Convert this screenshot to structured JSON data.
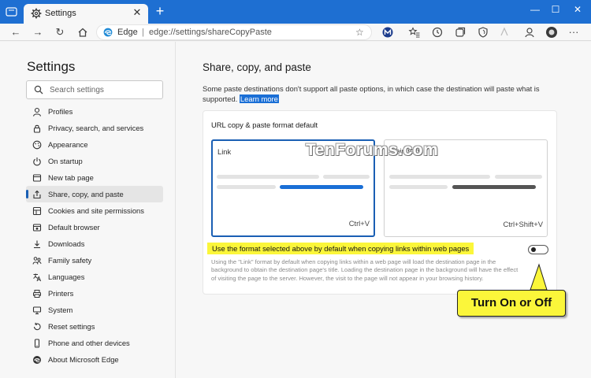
{
  "browser": {
    "tab_title": "Settings",
    "tab_close": "✕",
    "new_tab": "+",
    "window_controls": {
      "minimize": "—",
      "maximize": "☐",
      "close": "✕"
    },
    "address": {
      "brand": "Edge",
      "separator": "|",
      "url": "edge://settings/shareCopyPaste"
    },
    "accent": "#1e6fd2"
  },
  "sidebar": {
    "title": "Settings",
    "search_placeholder": "Search settings",
    "items": [
      {
        "label": "Profiles",
        "icon": "profile-icon"
      },
      {
        "label": "Privacy, search, and services",
        "icon": "lock-icon"
      },
      {
        "label": "Appearance",
        "icon": "appearance-icon"
      },
      {
        "label": "On startup",
        "icon": "power-icon"
      },
      {
        "label": "New tab page",
        "icon": "new-tab-page-icon"
      },
      {
        "label": "Share, copy, and paste",
        "icon": "share-icon",
        "active": true
      },
      {
        "label": "Cookies and site permissions",
        "icon": "permissions-icon"
      },
      {
        "label": "Default browser",
        "icon": "default-browser-icon"
      },
      {
        "label": "Downloads",
        "icon": "download-icon"
      },
      {
        "label": "Family safety",
        "icon": "family-icon"
      },
      {
        "label": "Languages",
        "icon": "languages-icon"
      },
      {
        "label": "Printers",
        "icon": "printer-icon"
      },
      {
        "label": "System",
        "icon": "system-icon"
      },
      {
        "label": "Reset settings",
        "icon": "reset-icon"
      },
      {
        "label": "Phone and other devices",
        "icon": "phone-icon"
      },
      {
        "label": "About Microsoft Edge",
        "icon": "edge-icon"
      }
    ]
  },
  "main": {
    "title": "Share, copy, and paste",
    "description": "Some paste destinations don't support all paste options, in which case the destination will paste what is supported.",
    "learn_more": "Learn more",
    "card": {
      "title": "URL copy & paste format default",
      "option_link": {
        "label": "Link",
        "shortcut": "Ctrl+V",
        "selected": true
      },
      "option_plain": {
        "label": "Plain text",
        "shortcut": "Ctrl+Shift+V",
        "selected": false
      },
      "toggle_label": "Use the format selected above by default when copying links within web pages",
      "toggle_desc": "Using the \"Link\" format by default when copying links within a web page will load the destination page in the background to obtain the destination page's title. Loading the destination page in the background will have the effect of visiting the page to the server. However, the visit to the page will not appear in your browsing history.",
      "toggle_on": false
    }
  },
  "watermark": "TenForums.com",
  "callout": "Turn On or Off"
}
